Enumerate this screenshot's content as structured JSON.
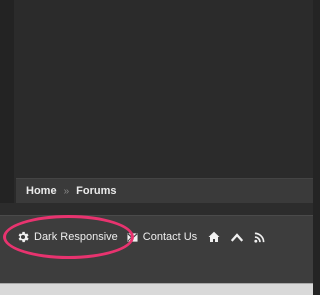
{
  "breadcrumb": {
    "items": [
      "Home",
      "Forums"
    ],
    "separator": "»"
  },
  "footer": {
    "style_chooser_label": "Dark Responsive",
    "contact_label": "Contact Us",
    "icons": [
      "gear-icon",
      "mail-icon",
      "home-icon",
      "chevron-up-icon",
      "rss-icon"
    ]
  },
  "colors": {
    "background": "#2b2b2b",
    "breadcrumb_bar": "#3a3a3a",
    "footer_bar": "#3d3d3d",
    "highlight": "#e8336f",
    "text": "#eeeeee"
  }
}
